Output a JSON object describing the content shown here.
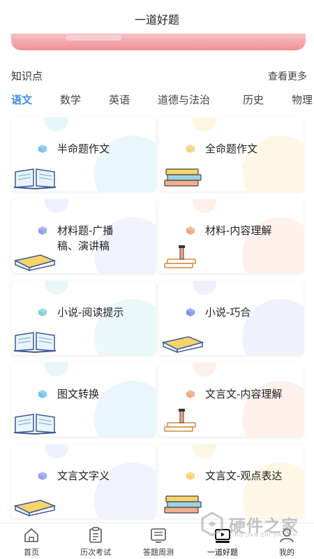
{
  "header": {
    "title": "一道好题"
  },
  "section": {
    "title": "知识点",
    "more": "查看更多"
  },
  "tabs": [
    {
      "label": "语文",
      "active": true
    },
    {
      "label": "数学",
      "active": false
    },
    {
      "label": "英语",
      "active": false
    },
    {
      "label": "道德与法治",
      "active": false
    },
    {
      "label": "历史",
      "active": false
    },
    {
      "label": "物理",
      "active": false
    }
  ],
  "cards": [
    {
      "label": "半命题作文",
      "cube_color": "#6fc3e8",
      "blob_color": "#d7eefa",
      "illustration": "open-book-icon"
    },
    {
      "label": "全命题作文",
      "cube_color": "#f7d36b",
      "blob_color": "#fdf0cf",
      "illustration": "book-stack-icon"
    },
    {
      "label": "材料题-广播稿、演讲稿",
      "cube_color": "#8b9cf0",
      "blob_color": "#e3e8fc",
      "illustration": "closed-book-icon"
    },
    {
      "label": "材料-内容理解",
      "cube_color": "#f2a47c",
      "blob_color": "#fde6da",
      "illustration": "books-pencil-icon"
    },
    {
      "label": "小说-阅读提示",
      "cube_color": "#7fd0d8",
      "blob_color": "#daf2f5",
      "illustration": "open-book-icon"
    },
    {
      "label": "小说-巧合",
      "cube_color": "#7d8ff0",
      "blob_color": "#e2e6fc",
      "illustration": "closed-book-icon"
    },
    {
      "label": "图文转换",
      "cube_color": "#6fc3e8",
      "blob_color": "#d7eefa",
      "illustration": "open-book-icon"
    },
    {
      "label": "文言文-内容理解",
      "cube_color": "#f2a47c",
      "blob_color": "#fde6da",
      "illustration": "books-pencil-icon"
    },
    {
      "label": "文言文字义",
      "cube_color": "#8b9cf0",
      "blob_color": "#e3e8fc",
      "illustration": "closed-book-icon"
    },
    {
      "label": "文言文-观点表达",
      "cube_color": "#f7d36b",
      "blob_color": "#fdf0cf",
      "illustration": "book-stack-icon"
    }
  ],
  "bottom_nav": [
    {
      "label": "首页",
      "icon": "home-icon"
    },
    {
      "label": "历次考试",
      "icon": "clipboard-icon"
    },
    {
      "label": "答题周测",
      "icon": "quiz-icon"
    },
    {
      "label": "一道好题",
      "icon": "video-icon",
      "active": true
    },
    {
      "label": "我的",
      "icon": "user-icon"
    }
  ],
  "watermark": {
    "text": "硬件之家",
    "sub": "YING JIAN ZHI JIA.COM"
  },
  "colors": {
    "accent": "#3a8ee6",
    "banner": "#f28e96"
  }
}
